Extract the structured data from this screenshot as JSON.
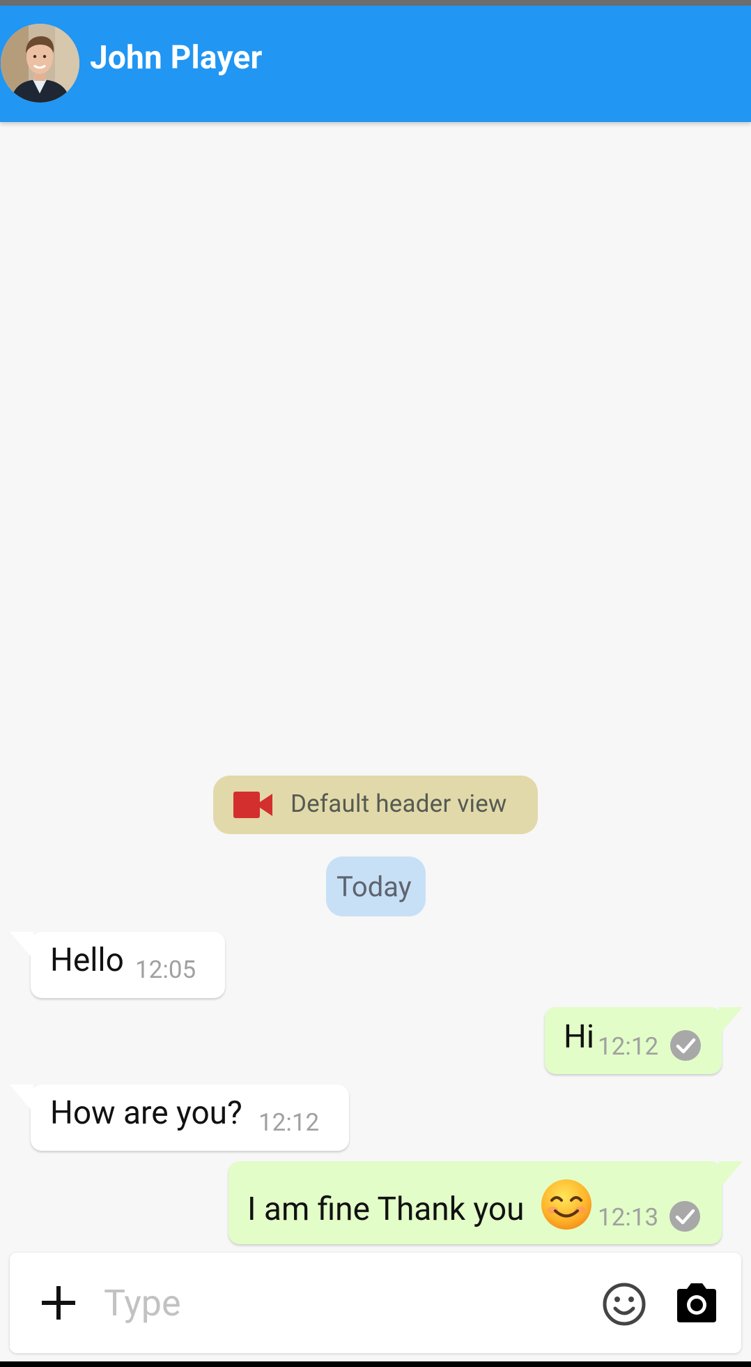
{
  "header": {
    "contact_name": "John Player",
    "avatar": "contact-avatar-photo",
    "background_color": "#2196f3"
  },
  "chat": {
    "header_view_label": "Default header view",
    "header_view_icon": "video-camera-icon",
    "date_separator": "Today",
    "messages": [
      {
        "direction": "incoming",
        "text": "Hello",
        "time": "12:05"
      },
      {
        "direction": "outgoing",
        "text": "Hi",
        "time": "12:12",
        "status": "read-check-icon"
      },
      {
        "direction": "incoming",
        "text": "How are you?",
        "time": "12:12"
      },
      {
        "direction": "outgoing",
        "text": "I am fine Thank you",
        "emoji": "😊",
        "time": "12:13",
        "status": "read-check-icon"
      }
    ]
  },
  "input_bar": {
    "placeholder": "Type",
    "value": "",
    "icons": [
      "plus-icon",
      "emoji-icon",
      "camera-icon"
    ]
  },
  "colors": {
    "incoming_bubble": "#ffffff",
    "outgoing_bubble": "#e2fdc8",
    "date_chip": "#c7e0f6",
    "header_chip": "#e2d9aa",
    "video_icon": "#d32f2f"
  }
}
